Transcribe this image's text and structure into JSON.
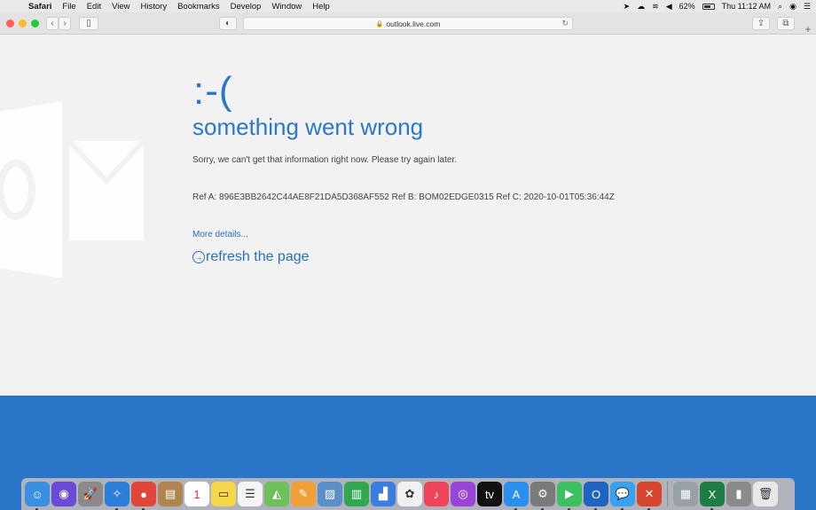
{
  "menubar": {
    "apple": "",
    "items": [
      "Safari",
      "File",
      "Edit",
      "View",
      "History",
      "Bookmarks",
      "Develop",
      "Window",
      "Help"
    ],
    "battery_percent": "62%",
    "clock": "Thu 11:12 AM"
  },
  "toolbar": {
    "url": "outlook.live.com"
  },
  "error": {
    "face": ":-(",
    "title": "something went wrong",
    "message": "Sorry, we can't get that information right now. Please try again later.",
    "reference": "Ref A: 896E3BB2642C44AE8F21DA5D368AF552 Ref B: BOM02EDGE0315 Ref C: 2020-10-01T05:36:44Z",
    "more_details": "More details...",
    "refresh": "refresh the page"
  },
  "colors": {
    "accent": "#2b78c5",
    "bottom_bar": "#2a75c7",
    "page_bg": "#f2f2f2"
  },
  "dock": {
    "items": [
      {
        "name": "finder",
        "glyph": "☺",
        "color": "#3b8fe0"
      },
      {
        "name": "siri",
        "glyph": "◉",
        "color": "#6b4bd6"
      },
      {
        "name": "launchpad",
        "glyph": "🚀",
        "color": "#8a8a8a"
      },
      {
        "name": "safari",
        "glyph": "✧",
        "color": "#2b7fd8"
      },
      {
        "name": "chrome",
        "glyph": "●",
        "color": "#e0463a"
      },
      {
        "name": "notefile",
        "glyph": "▤",
        "color": "#b08450"
      },
      {
        "name": "calendar",
        "glyph": "1",
        "color": "#ffffff"
      },
      {
        "name": "notes",
        "glyph": "▭",
        "color": "#f5d84a"
      },
      {
        "name": "reminders",
        "glyph": "☰",
        "color": "#f4f4f4"
      },
      {
        "name": "maps",
        "glyph": "◭",
        "color": "#6fbf5a"
      },
      {
        "name": "pages",
        "glyph": "✎",
        "color": "#f0a036"
      },
      {
        "name": "preview",
        "glyph": "▨",
        "color": "#5b8fc8"
      },
      {
        "name": "numbers",
        "glyph": "▥",
        "color": "#2fa84f"
      },
      {
        "name": "keynote",
        "glyph": "▟",
        "color": "#3b7de0"
      },
      {
        "name": "photos",
        "glyph": "✿",
        "color": "#f1f1f1"
      },
      {
        "name": "music",
        "glyph": "♪",
        "color": "#f0445a"
      },
      {
        "name": "podcasts",
        "glyph": "◎",
        "color": "#9b45d8"
      },
      {
        "name": "apple-tv",
        "glyph": "tv",
        "color": "#111111"
      },
      {
        "name": "app-store",
        "glyph": "A",
        "color": "#2b8ff0"
      },
      {
        "name": "system-preferences",
        "glyph": "⚙",
        "color": "#7a7a7a"
      },
      {
        "name": "facetime",
        "glyph": "▶",
        "color": "#3cc060"
      },
      {
        "name": "outlook",
        "glyph": "O",
        "color": "#1f64c0"
      },
      {
        "name": "messages",
        "glyph": "💬",
        "color": "#3aa0f0"
      },
      {
        "name": "remote-desktop",
        "glyph": "✕",
        "color": "#d6462e"
      },
      {
        "name": "image-capture",
        "glyph": "▦",
        "color": "#9aa0a8"
      },
      {
        "name": "excel",
        "glyph": "X",
        "color": "#1e7d45"
      },
      {
        "name": "archive",
        "glyph": "▮",
        "color": "#8a8a8a"
      },
      {
        "name": "trash",
        "glyph": "🗑",
        "color": "#e8e8e8"
      }
    ]
  }
}
